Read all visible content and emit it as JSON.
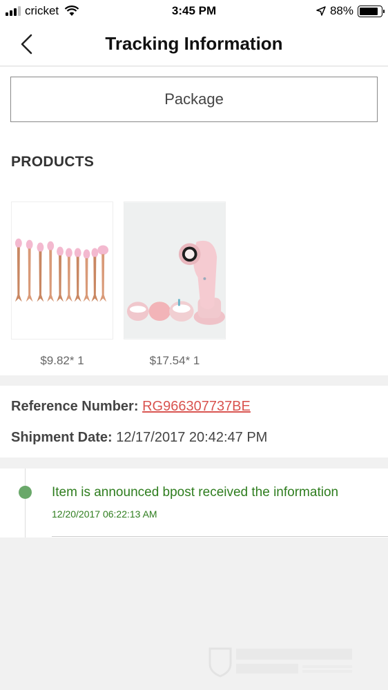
{
  "status_bar": {
    "carrier": "cricket",
    "time": "3:45 PM",
    "battery": "88%",
    "battery_level": 0.88
  },
  "nav": {
    "title": "Tracking Information",
    "back_icon": "chevron-left-icon"
  },
  "package_button": "Package",
  "products": {
    "heading": "PRODUCTS",
    "items": [
      {
        "image": "mermaid-makeup-brush-set",
        "price": "$9.82* 1"
      },
      {
        "image": "pink-facial-cleansing-brush",
        "price": "$17.54* 1"
      }
    ]
  },
  "shipment": {
    "reference_label": "Reference Number:",
    "reference_value": "RG966307737BE",
    "date_label": "Shipment Date:",
    "date_value": "12/17/2017 20:42:47 PM"
  },
  "timeline": [
    {
      "status": "Item is announced   bpost received the information",
      "time": "12/20/2017 06:22:13 AM"
    }
  ],
  "colors": {
    "accent_red": "#d9534f",
    "timeline_green": "#2e7d1e",
    "timeline_dot": "#6aa86a"
  }
}
